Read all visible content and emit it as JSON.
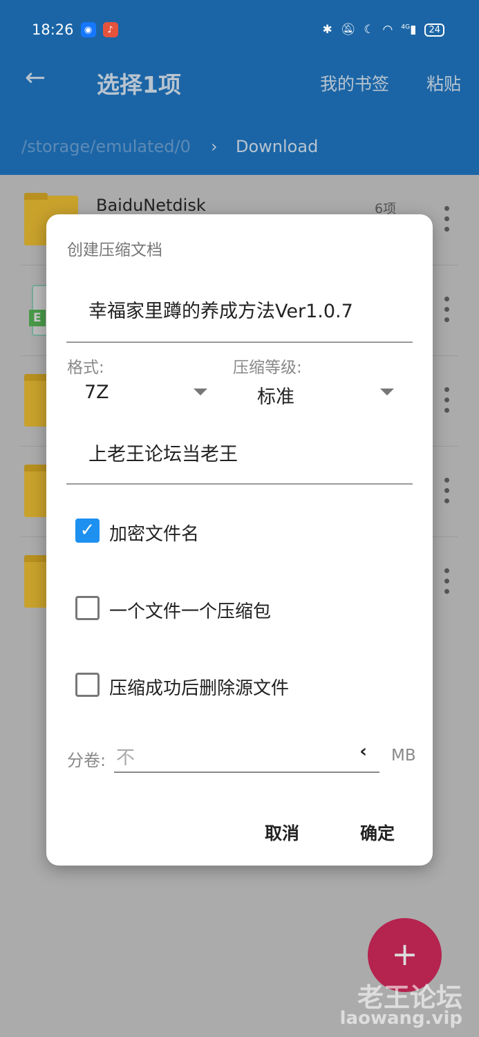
{
  "status": {
    "time": "18:26",
    "battery": "24",
    "network": "4G"
  },
  "header": {
    "title": "选择1项",
    "bookmarks": "我的书签",
    "paste": "粘贴",
    "path": "/storage/emulated/0",
    "sep": "›",
    "current": "Download"
  },
  "list": [
    {
      "name": "BaiduNetdisk",
      "count": "6项",
      "badge": ""
    },
    {
      "name": "",
      "count": "",
      "badge": "E"
    },
    {
      "name": "",
      "count": "",
      "badge": ""
    },
    {
      "name": "",
      "count": "",
      "badge": ""
    },
    {
      "name": "",
      "count": "",
      "badge": ""
    }
  ],
  "dialog": {
    "title": "创建压缩文档",
    "filename": "幸福家里蹲的养成方法Ver1.0.7",
    "format_label": "格式:",
    "format_value": "7Z",
    "level_label": "压缩等级:",
    "level_value": "标准",
    "password": "上老王论坛当老王",
    "options": [
      {
        "label": "加密文件名",
        "checked": true
      },
      {
        "label": "一个文件一个压缩包",
        "checked": false
      },
      {
        "label": "压缩成功后删除源文件",
        "checked": false
      }
    ],
    "split_label": "分卷:",
    "split_placeholder": "不",
    "split_unit": "MB",
    "cancel": "取消",
    "ok": "确定"
  },
  "fab": "+",
  "watermark": {
    "line1": "老王论坛",
    "line2": "laowang.vip"
  },
  "colors": {
    "header": "#1b65a6",
    "accent": "#1e90f0",
    "fab": "#b5234f"
  }
}
